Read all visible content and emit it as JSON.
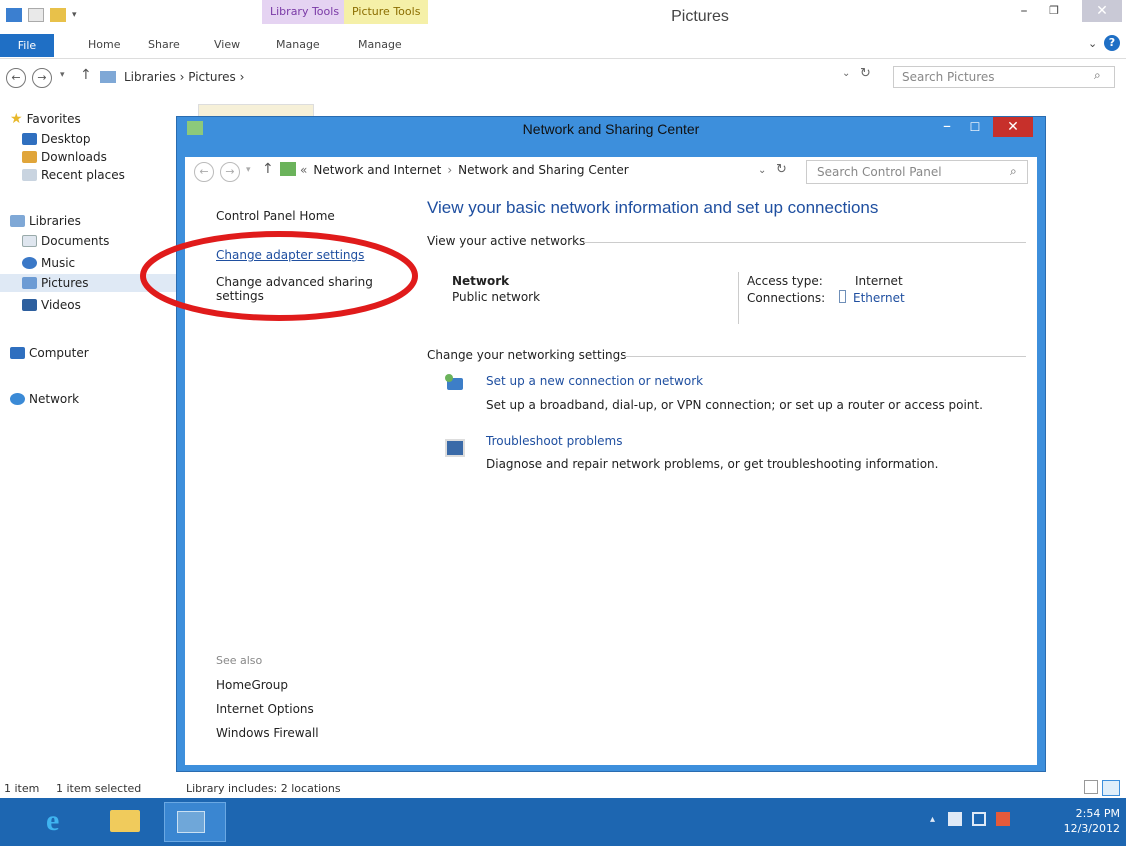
{
  "explorer": {
    "title": "Pictures",
    "context_tabs": {
      "library_tools": "Library Tools",
      "picture_tools": "Picture Tools"
    },
    "ribbon_tabs": [
      "File",
      "Home",
      "Share",
      "View",
      "Manage",
      "Manage"
    ],
    "address_path": "Libraries  ›  Pictures  ›",
    "search_placeholder": "Search Pictures",
    "nav": {
      "favorites": "Favorites",
      "desktop": "Desktop",
      "downloads": "Downloads",
      "recent_places": "Recent places",
      "libraries": "Libraries",
      "documents": "Documents",
      "music": "Music",
      "pictures": "Pictures",
      "videos": "Videos",
      "computer": "Computer",
      "network": "Network"
    },
    "status": {
      "items": "1 item",
      "selected": "1 item selected",
      "library": "Library includes: 2 locations"
    }
  },
  "nsc": {
    "title": "Network and Sharing Center",
    "address": {
      "prefix": "«",
      "crumb1": "Network and Internet",
      "sep": "›",
      "crumb2": "Network and Sharing Center"
    },
    "search_placeholder": "Search Control Panel",
    "sidebar": {
      "home": "Control Panel Home",
      "change_adapter": "Change adapter settings",
      "change_advanced_line1": "Change advanced sharing",
      "change_advanced_line2": "settings",
      "see_also": "See also",
      "homegroup": "HomeGroup",
      "internet_options": "Internet Options",
      "windows_firewall": "Windows Firewall"
    },
    "heading": "View your basic network information and set up connections",
    "active_networks_label": "View your active networks",
    "network_name": "Network",
    "network_type": "Public network",
    "access_type_label": "Access type:",
    "access_type_value": "Internet",
    "connections_label": "Connections:",
    "connections_value": "Ethernet",
    "change_settings_label": "Change your networking settings",
    "setup_link": "Set up a new connection or network",
    "setup_desc": "Set up a broadband, dial-up, or VPN connection; or set up a router or access point.",
    "troubleshoot_link": "Troubleshoot problems",
    "troubleshoot_desc": "Diagnose and repair network problems, or get troubleshooting information."
  },
  "taskbar": {
    "time": "2:54 PM",
    "date": "12/3/2012"
  },
  "colors": {
    "titlebar_blue": "#3d8fdc",
    "link_blue": "#1f4fa0",
    "taskbar": "#1d66b1",
    "close_red": "#c7302b",
    "highlight_ellipse": "#e01b1b"
  }
}
